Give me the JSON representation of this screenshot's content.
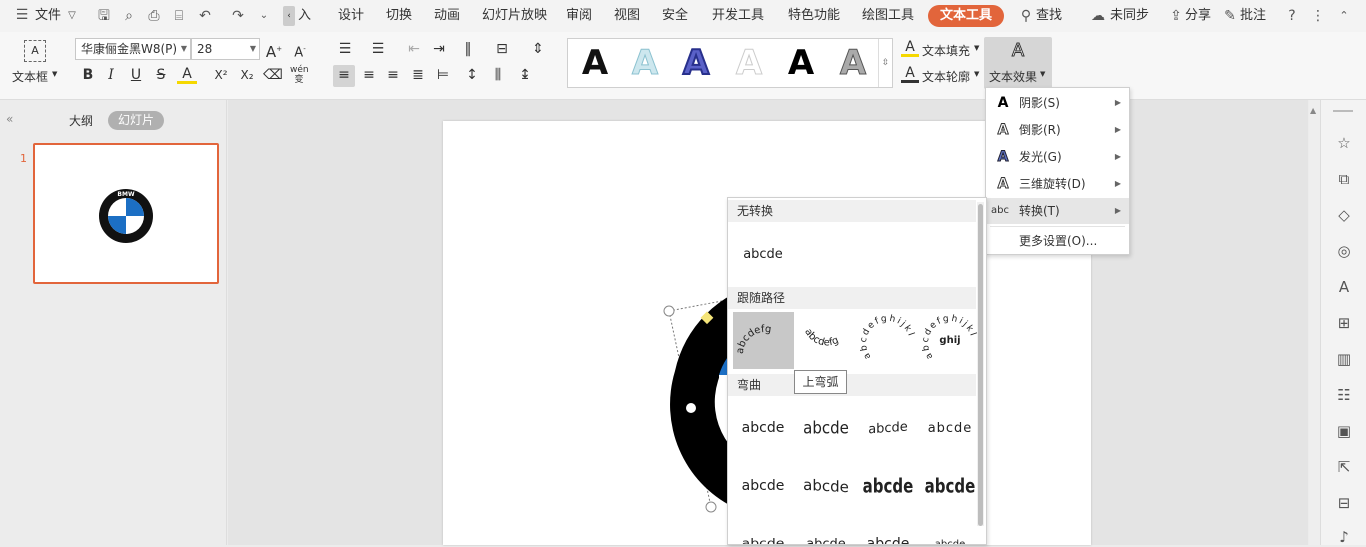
{
  "menubar": {
    "file_label": "文件",
    "tabs": [
      "设计",
      "切换",
      "动画",
      "幻灯片放映",
      "审阅",
      "视图",
      "安全",
      "开发工具",
      "特色功能",
      "绘图工具",
      "文本工具"
    ],
    "partial_tab": "入",
    "search_label": "查找",
    "sync_label": "未同步",
    "share_label": "分享",
    "comment_label": "批注"
  },
  "ribbon": {
    "textbox_label": "文本框",
    "font_name": "华康俪金黑W8(P)",
    "font_size": "28",
    "text_fill_label": "文本填充",
    "text_outline_label": "文本轮廓",
    "text_effect_label": "文本效果",
    "bold": "B",
    "italic": "I",
    "underline": "U",
    "strike": "S",
    "sup": "X²",
    "sub": "X₂",
    "phonetic": "wén"
  },
  "gallery": {
    "glyph": "A"
  },
  "leftpane": {
    "outline_tab": "大纲",
    "slides_tab": "幻灯片",
    "slide_number": "1",
    "logo_letters": "BMW"
  },
  "effect_menu": {
    "items": [
      {
        "label": "阴影(S)",
        "icon": "A"
      },
      {
        "label": "倒影(R)",
        "icon": "A"
      },
      {
        "label": "发光(G)",
        "icon": "A"
      },
      {
        "label": "三维旋转(D)",
        "icon": "A"
      },
      {
        "label": "转换(T)",
        "icon": "abc"
      }
    ],
    "more": "更多设置(O)..."
  },
  "transform_panel": {
    "no_transform": "无转换",
    "sample": "abcde",
    "follow_path": "跟随路径",
    "path_samples": [
      "abcdefg",
      "abcdefg",
      "abcdefghijkl",
      "abcdefghijkl"
    ],
    "path_center": "ghij",
    "warp": "弯曲",
    "warp_sample": "abcde",
    "tooltip": "上弯弧"
  },
  "colors": {
    "accent": "#e2653b",
    "bmw_blue": "#1c6fc4"
  }
}
